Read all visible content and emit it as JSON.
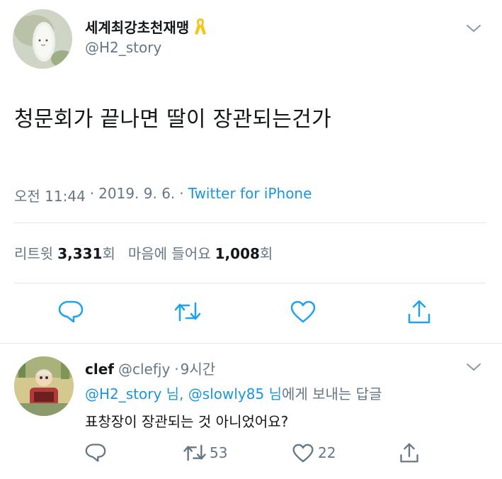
{
  "tweet": {
    "display_name": "세계최강초천재맹",
    "ribbon_emoji": "🎗",
    "handle": "@H2_story",
    "text": "청문회가 끝나면 딸이 장관되는건가",
    "time": "오전 11:44",
    "date": "2019. 9. 6.",
    "dot": "·",
    "source": "Twitter for iPhone",
    "stats": {
      "retweets_label": "리트윗",
      "retweets_count": "3,331",
      "retweets_unit": "회",
      "likes_label": "마음에 들어요",
      "likes_count": "1,008",
      "likes_unit": "회"
    }
  },
  "reply": {
    "display_name": "clef",
    "handle": "@clefjy",
    "dot": "·",
    "time": "9시간",
    "replying_to_user1": "@H2_story 님",
    "comma": ",",
    "replying_to_user2": "@slowly85 님",
    "replying_suffix": "에게 보내는 답글",
    "text": "표창장이 장관되는 것 아니었어요?",
    "retweet_count": "53",
    "like_count": "22"
  },
  "colors": {
    "accent": "#1b95e0",
    "icon": "#1da1f2",
    "muted": "#657786",
    "divider": "#e1e8ed",
    "ribbon": "#f5c518"
  },
  "icons": [
    "chevron-down-icon",
    "reply-icon",
    "retweet-icon",
    "heart-icon",
    "share-icon"
  ]
}
